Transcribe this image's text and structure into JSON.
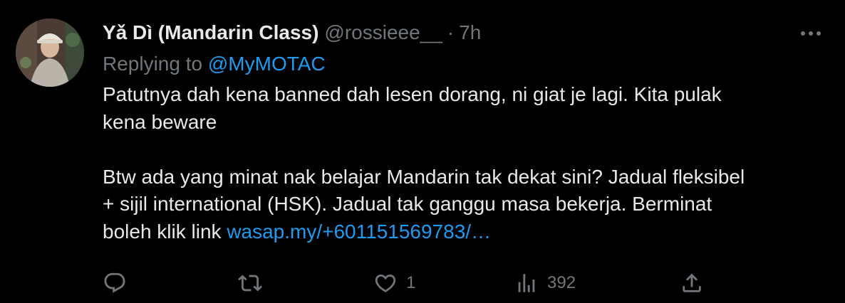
{
  "tweet": {
    "author_name": "Yǎ Dì (Mandarin Class)",
    "handle": "@rossieee__",
    "separator": "·",
    "time": "7h",
    "replying_prefix": "Replying to",
    "replying_handle": "@MyMOTAC",
    "body_line1": "Patutnya dah kena banned dah lesen dorang, ni giat je lagi. Kita pulak",
    "body_line2": "kena beware",
    "body_para2_line1": "Btw ada yang minat nak belajar Mandarin tak dekat sini? Jadual fleksibel",
    "body_para2_line2": "+ sijil international (HSK). Jadual tak ganggu masa bekerja. Berminat",
    "body_para2_line3_prefix": "boleh klik link",
    "link_text": "wasap.my/+601151569783/…"
  },
  "actions": {
    "reply_icon": "reply-icon",
    "retweet_icon": "retweet-icon",
    "like_icon": "like-icon",
    "like_count": "1",
    "views_icon": "views-icon",
    "views_count": "392",
    "share_icon": "share-icon",
    "more_icon": "more-icon"
  },
  "colors": {
    "background": "#000000",
    "text": "#e7e9ea",
    "secondary": "#71767b",
    "link": "#1d9bf0"
  }
}
